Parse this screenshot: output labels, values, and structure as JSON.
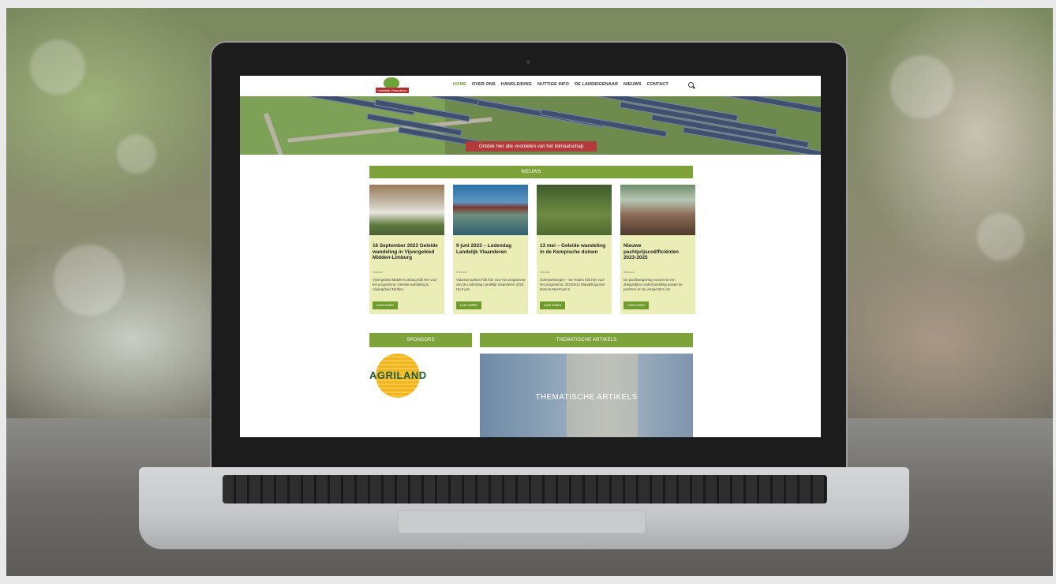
{
  "nav": {
    "logo_text": "Landelijk Vlaanderen",
    "items": [
      {
        "label": "HOME",
        "active": true
      },
      {
        "label": "OVER ONS",
        "active": false
      },
      {
        "label": "HANDLEIDING",
        "active": false
      },
      {
        "label": "NUTTIGE INFO",
        "active": false
      },
      {
        "label": "DE LANDEIGENAAR",
        "active": false
      },
      {
        "label": "NIEUWS",
        "active": false
      },
      {
        "label": "CONTACT",
        "active": false
      }
    ],
    "search_icon": "search-icon"
  },
  "hero": {
    "cta": "Ontdek hier alle voordelen van het lidmaatschap"
  },
  "news": {
    "heading": "NIEUWS",
    "cards": [
      {
        "title": "16 September 2023 Geleide wandeling in Vijvergebied Midden-Limburg",
        "category": "Nieuws",
        "excerpt": "Vijvergebied Midden-Limburg Klik hier voor het programma: Geleide wandeling in Vijvergebied Midden-",
        "button": "Lees verder"
      },
      {
        "title": "9 juni 2023 – Ledendag Landelijk Vlaanderen",
        "category": "Nieuws",
        "excerpt": "Vlaamse parken Klik hier voor het programma van de Ledendag Landelijk Vlaanderen 2023. Op 9 juni",
        "button": "Lees verder"
      },
      {
        "title": "13 mei – Geleide wandeling in de Kempische duinen",
        "category": "Nieuws",
        "excerpt": "Scherpenbergen – De Hutten Klik hier voor het programma: 20230513 Wandeling privé domein Meerhout In",
        "button": "Lees verder"
      },
      {
        "title": "Nieuwe pachtprijscoëfficiënten 2023-2025",
        "category": "Nieuws",
        "excerpt": "De pachtwetgeving voorziet in een driejaarlijkse onderhandeling tussen de pachters en de verpachters om",
        "button": "Lees verder"
      }
    ]
  },
  "sponsors": {
    "heading": "SPONSORS",
    "logo_text": "AGRILAND"
  },
  "thematic": {
    "heading": "THEMATISCHE ARTIKELS",
    "image_title": "THEMATISCHE ARTIKELS"
  },
  "colors": {
    "accent_green": "#7ea33a",
    "cta_red": "#b33a3a",
    "card_bg": "#eaeeb6"
  }
}
